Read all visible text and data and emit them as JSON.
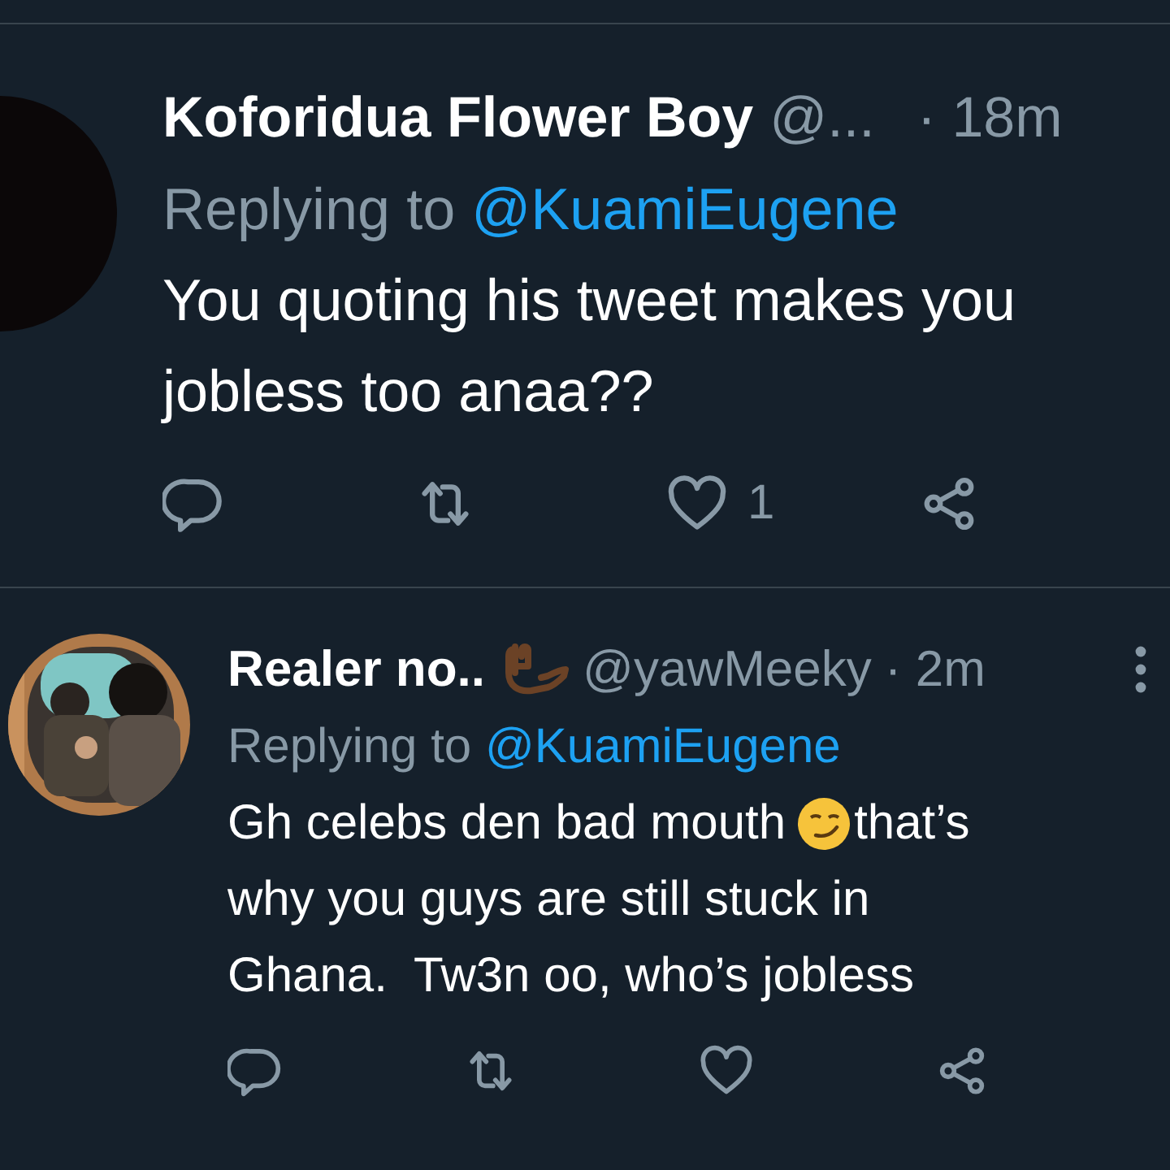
{
  "tweets": [
    {
      "avatar": {
        "kind": "plain"
      },
      "name": "Koforidua Flower Boy",
      "name_badge": false,
      "handle": "@...",
      "time": "· 18m",
      "menu": false,
      "replying_label": "Replying to",
      "reply_to": "@KuamiEugene",
      "lines": [
        [
          {
            "kind": "text",
            "text": "You quoting his tweet makes you"
          }
        ],
        [
          {
            "kind": "text",
            "text": "jobless too anaa??"
          }
        ]
      ],
      "liked": false,
      "like_count": "1"
    },
    {
      "avatar": {
        "kind": "picture"
      },
      "name": "Realer no..",
      "name_badge": true,
      "handle": "@yawMeeky",
      "time": "· 2m",
      "menu": true,
      "replying_label": "Replying to",
      "reply_to": "@KuamiEugene",
      "lines": [
        [
          {
            "kind": "text",
            "text": "Gh celebs den bad mouth"
          },
          {
            "kind": "emoji"
          },
          {
            "kind": "text",
            "text": "that’s"
          }
        ],
        [
          {
            "kind": "text",
            "text": "why you guys are still stuck in"
          }
        ],
        [
          {
            "kind": "text",
            "text": "Ghana.  Tw3n oo, who’s jobless"
          }
        ]
      ],
      "liked": false
    }
  ]
}
